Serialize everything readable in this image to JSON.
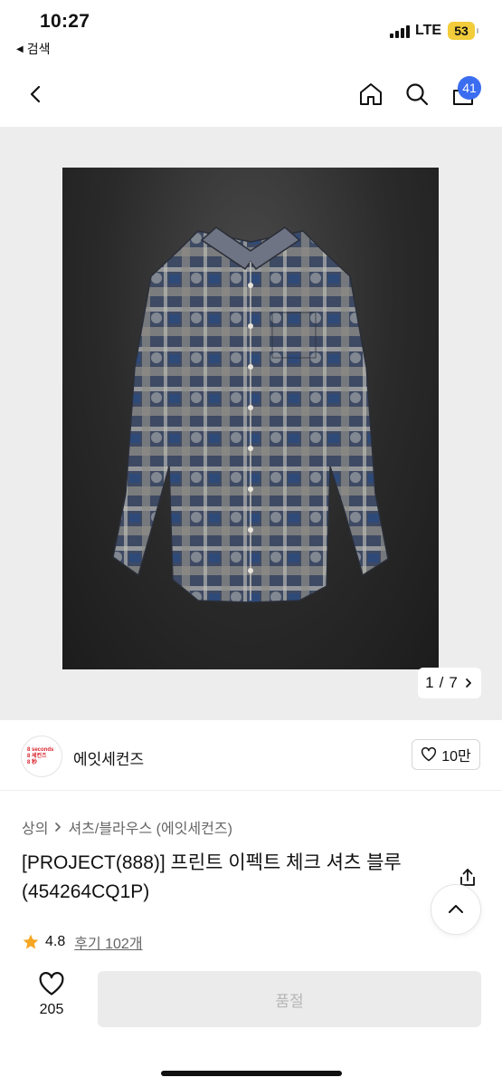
{
  "status_bar": {
    "time": "10:27",
    "back_app": "검색",
    "network": "LTE",
    "battery": "53"
  },
  "nav": {
    "cart_count": "41"
  },
  "gallery": {
    "counter_current": "1",
    "counter_sep": "/",
    "counter_total": "7",
    "image_subject": "printed check shirt, blue"
  },
  "brand": {
    "logo_lines": [
      "8 seconds",
      "8 세컨즈",
      "8 秒"
    ],
    "name": "에잇세컨즈",
    "likes": "10만"
  },
  "product": {
    "breadcrumb": [
      "상의",
      "셔츠/블라우스 (에잇세컨즈)"
    ],
    "title": "[PROJECT(888)] 프린트 이펙트 체크 셔츠 블루 (454264CQ1P)",
    "rating": "4.8",
    "reviews": "후기 102개"
  },
  "bottom_bar": {
    "like_count": "205",
    "purchase_label": "품절"
  },
  "colors": {
    "accent": "#3b6df0",
    "rating_star": "#f5a623",
    "brand_red": "#d9232d",
    "disabled_bg": "#ebebeb",
    "disabled_text": "#b6b6b6"
  }
}
